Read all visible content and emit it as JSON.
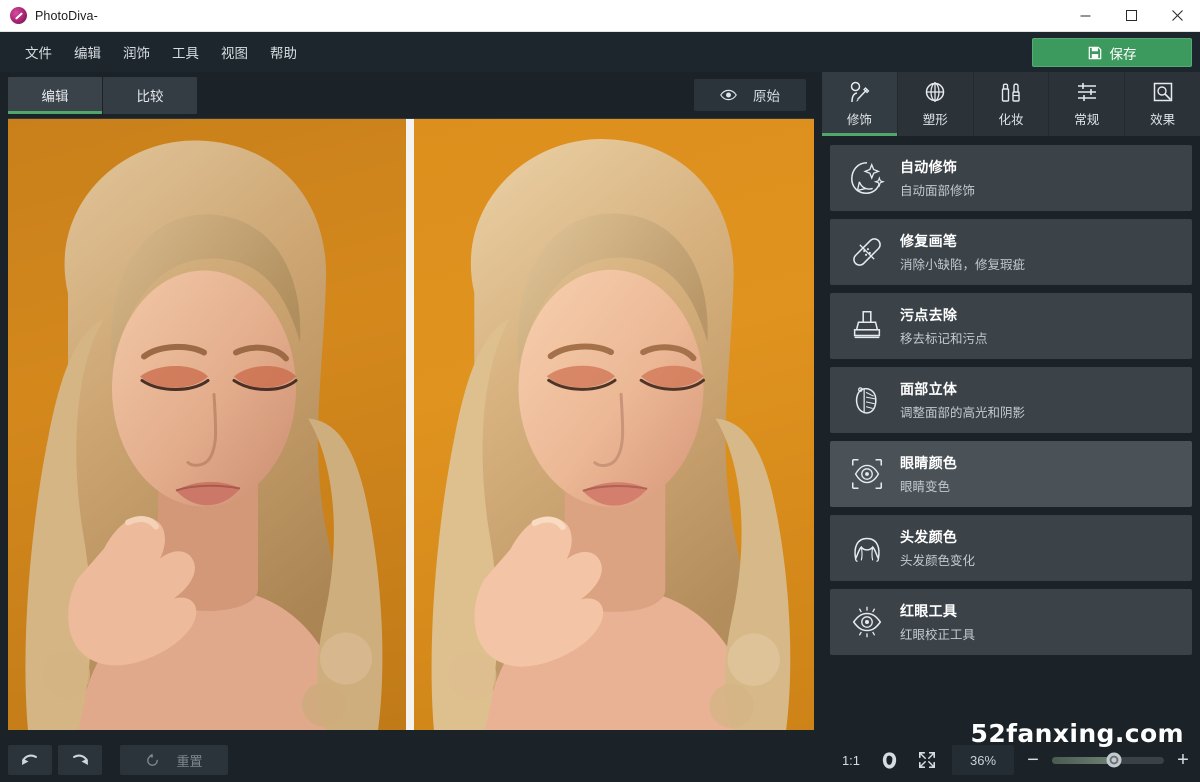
{
  "window": {
    "title": "PhotoDiva-",
    "logo_icon": "photodiva-logo-icon",
    "minimize_icon": "minimize-icon",
    "maximize_icon": "maximize-icon",
    "close_icon": "close-icon"
  },
  "menu": {
    "items": [
      {
        "label": "文件"
      },
      {
        "label": "编辑"
      },
      {
        "label": "润饰"
      },
      {
        "label": "工具"
      },
      {
        "label": "视图"
      },
      {
        "label": "帮助"
      }
    ],
    "save": {
      "label": "保存",
      "icon": "save-disk-icon",
      "color": "#3d9a5f"
    }
  },
  "workspace": {
    "mode_tabs": [
      {
        "label": "编辑",
        "active": true
      },
      {
        "label": "比较",
        "active": false
      }
    ],
    "original_button": {
      "label": "原始",
      "icon": "eye-icon"
    },
    "compare_view": {
      "before_label": "",
      "after_label": "",
      "divider_color": "#f4f3f0",
      "background_before": "#c9801b",
      "background_after": "#dd8f1d"
    }
  },
  "panel": {
    "tabs": [
      {
        "label": "修饰",
        "icon": "retouch-face-icon",
        "active": true
      },
      {
        "label": "塑形",
        "icon": "reshape-globe-icon",
        "active": false
      },
      {
        "label": "化妆",
        "icon": "makeup-lipstick-icon",
        "active": false
      },
      {
        "label": "常规",
        "icon": "sliders-icon",
        "active": false
      },
      {
        "label": "效果",
        "icon": "effects-frame-icon",
        "active": false
      }
    ],
    "tools": [
      {
        "title": "自动修饰",
        "subtitle": "自动面部修饰",
        "icon": "auto-retouch-icon",
        "selected": false
      },
      {
        "title": "修复画笔",
        "subtitle": "消除小缺陷，修复瑕疵",
        "icon": "healing-brush-icon",
        "selected": false
      },
      {
        "title": "污点去除",
        "subtitle": "移去标记和污点",
        "icon": "clone-stamp-icon",
        "selected": false
      },
      {
        "title": "面部立体",
        "subtitle": "调整面部的高光和阴影",
        "icon": "face-sculpt-icon",
        "selected": false
      },
      {
        "title": "眼睛颜色",
        "subtitle": "眼睛变色",
        "icon": "eye-color-icon",
        "selected": true
      },
      {
        "title": "头发颜色",
        "subtitle": "头发颜色变化",
        "icon": "hair-color-icon",
        "selected": false
      },
      {
        "title": "红眼工具",
        "subtitle": "红眼校正工具",
        "icon": "red-eye-icon",
        "selected": false
      }
    ]
  },
  "bottombar": {
    "undo": {
      "label": "",
      "icon": "undo-icon"
    },
    "redo": {
      "label": "",
      "icon": "redo-icon"
    },
    "reset": {
      "label": "重置",
      "icon": "reset-circular-arrow-icon"
    },
    "one_to_one": {
      "label": "1:1"
    },
    "face_fit": {
      "icon": "face-fit-icon"
    },
    "fit_screen": {
      "icon": "fit-screen-icon"
    },
    "zoom_value": "36%",
    "zoom_minus": "−",
    "zoom_plus": "+",
    "zoom_slider_percent": 55
  },
  "watermark": {
    "text": "52fanxing.com"
  },
  "colors": {
    "accent_green": "#4fa86a",
    "panel_bg": "#1b2329",
    "tool_item_bg": "#3b4248",
    "tool_item_selected_bg": "#4a5157"
  }
}
